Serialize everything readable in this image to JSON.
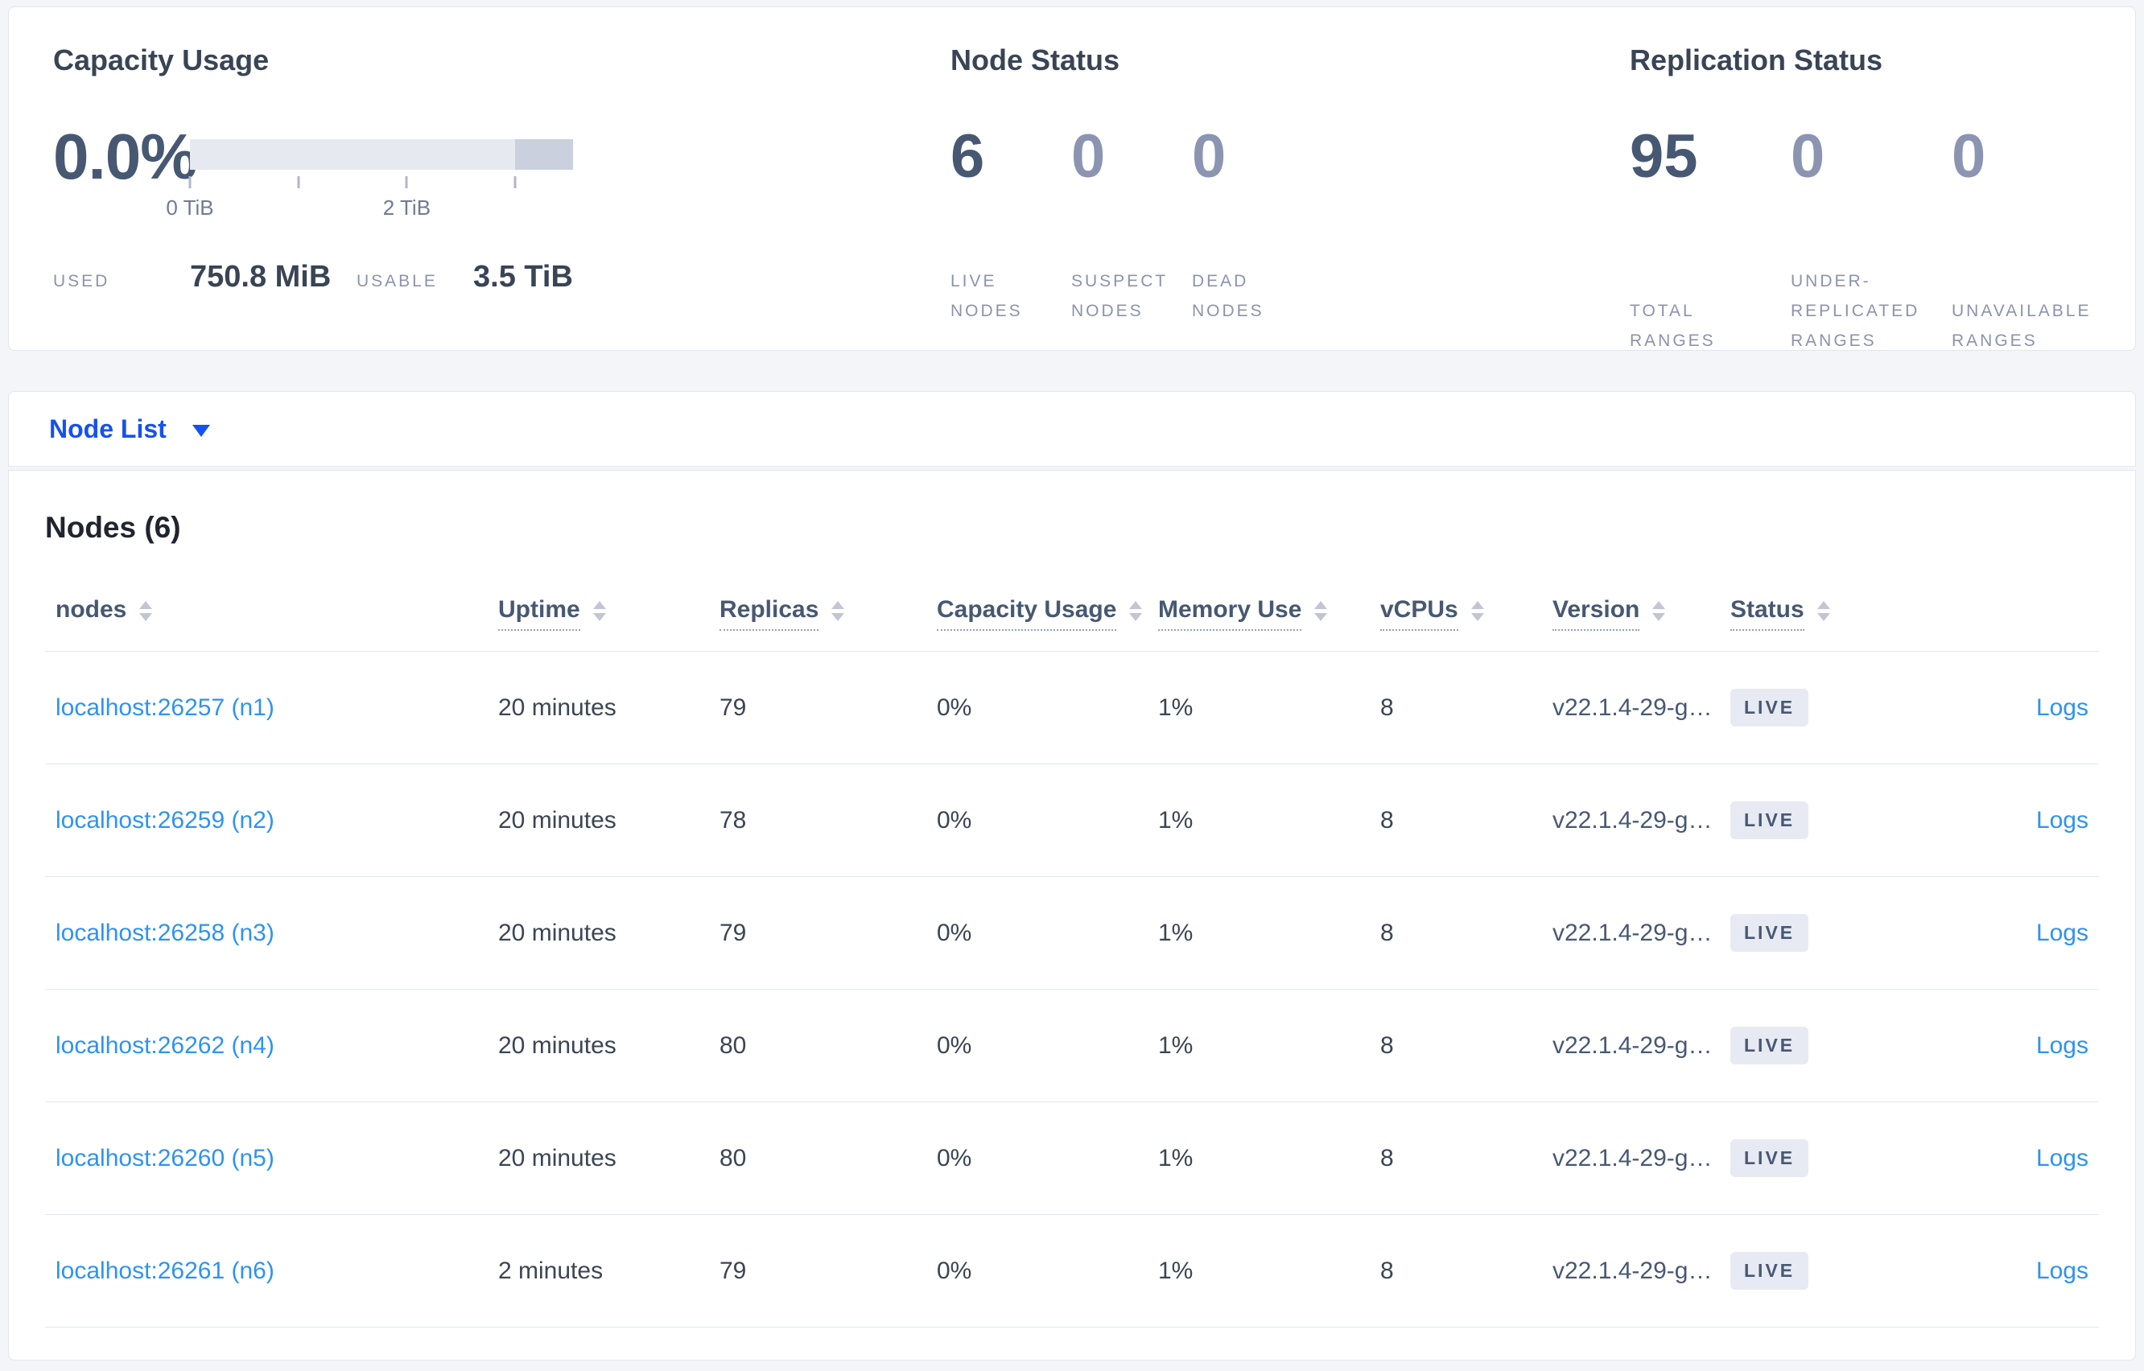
{
  "summary": {
    "capacity": {
      "title": "Capacity Usage",
      "percent": "0.0%",
      "bar": {
        "light_color": "#e7e9f1",
        "dark_color": "#cad0dd",
        "dark_segment_from_percent": 84.8,
        "ticks": [
          {
            "label": "0 TiB",
            "x_percent": 0
          },
          {
            "label": "",
            "x_percent": 28.3
          },
          {
            "label": "2 TiB",
            "x_percent": 56.6
          },
          {
            "label": "",
            "x_percent": 84.8
          }
        ]
      },
      "used_label": "USED",
      "used_value": "750.8 MiB",
      "usable_label": "USABLE",
      "usable_value": "3.5 TiB"
    },
    "node_status": {
      "title": "Node Status",
      "stats": [
        {
          "value": "6",
          "label": "LIVE NODES",
          "emphasized": true
        },
        {
          "value": "0",
          "label": "SUSPECT NODES",
          "emphasized": false
        },
        {
          "value": "0",
          "label": "DEAD NODES",
          "emphasized": false
        }
      ]
    },
    "replication": {
      "title": "Replication Status",
      "stats": [
        {
          "value": "95",
          "label": "TOTAL RANGES",
          "emphasized": true
        },
        {
          "value": "0",
          "label": "UNDER-REPLICATED RANGES",
          "emphasized": false
        },
        {
          "value": "0",
          "label": "UNAVAILABLE RANGES",
          "emphasized": false
        }
      ]
    }
  },
  "node_list": {
    "label": "Node List"
  },
  "nodes_section": {
    "title": "Nodes (6)",
    "columns": [
      {
        "label": "nodes",
        "underlined": false
      },
      {
        "label": "Uptime",
        "underlined": true
      },
      {
        "label": "Replicas",
        "underlined": true
      },
      {
        "label": "Capacity Usage",
        "underlined": true
      },
      {
        "label": "Memory Use",
        "underlined": true
      },
      {
        "label": "vCPUs",
        "underlined": true
      },
      {
        "label": "Version",
        "underlined": true
      },
      {
        "label": "Status",
        "underlined": true
      },
      {
        "label": "",
        "underlined": false
      }
    ],
    "rows": [
      {
        "address": "localhost:26257 (n1)",
        "uptime": "20 minutes",
        "replicas": "79",
        "capacity": "0%",
        "memory": "1%",
        "vcpus": "8",
        "version": "v22.1.4-29-g…",
        "status": "LIVE",
        "logs": "Logs"
      },
      {
        "address": "localhost:26259 (n2)",
        "uptime": "20 minutes",
        "replicas": "78",
        "capacity": "0%",
        "memory": "1%",
        "vcpus": "8",
        "version": "v22.1.4-29-g…",
        "status": "LIVE",
        "logs": "Logs"
      },
      {
        "address": "localhost:26258 (n3)",
        "uptime": "20 minutes",
        "replicas": "79",
        "capacity": "0%",
        "memory": "1%",
        "vcpus": "8",
        "version": "v22.1.4-29-g…",
        "status": "LIVE",
        "logs": "Logs"
      },
      {
        "address": "localhost:26262 (n4)",
        "uptime": "20 minutes",
        "replicas": "80",
        "capacity": "0%",
        "memory": "1%",
        "vcpus": "8",
        "version": "v22.1.4-29-g…",
        "status": "LIVE",
        "logs": "Logs"
      },
      {
        "address": "localhost:26260 (n5)",
        "uptime": "20 minutes",
        "replicas": "80",
        "capacity": "0%",
        "memory": "1%",
        "vcpus": "8",
        "version": "v22.1.4-29-g…",
        "status": "LIVE",
        "logs": "Logs"
      },
      {
        "address": "localhost:26261 (n6)",
        "uptime": "2 minutes",
        "replicas": "79",
        "capacity": "0%",
        "memory": "1%",
        "vcpus": "8",
        "version": "v22.1.4-29-g…",
        "status": "LIVE",
        "logs": "Logs"
      }
    ]
  },
  "colors": {
    "accent_link": "#2e93f0",
    "node_list_blue": "#1551f0",
    "title_text": "#394455",
    "metric_dark": "#475872",
    "metric_muted": "#8b95b1",
    "badge_bg": "#e7eaf3",
    "page_bg": "#f4f5f9"
  }
}
